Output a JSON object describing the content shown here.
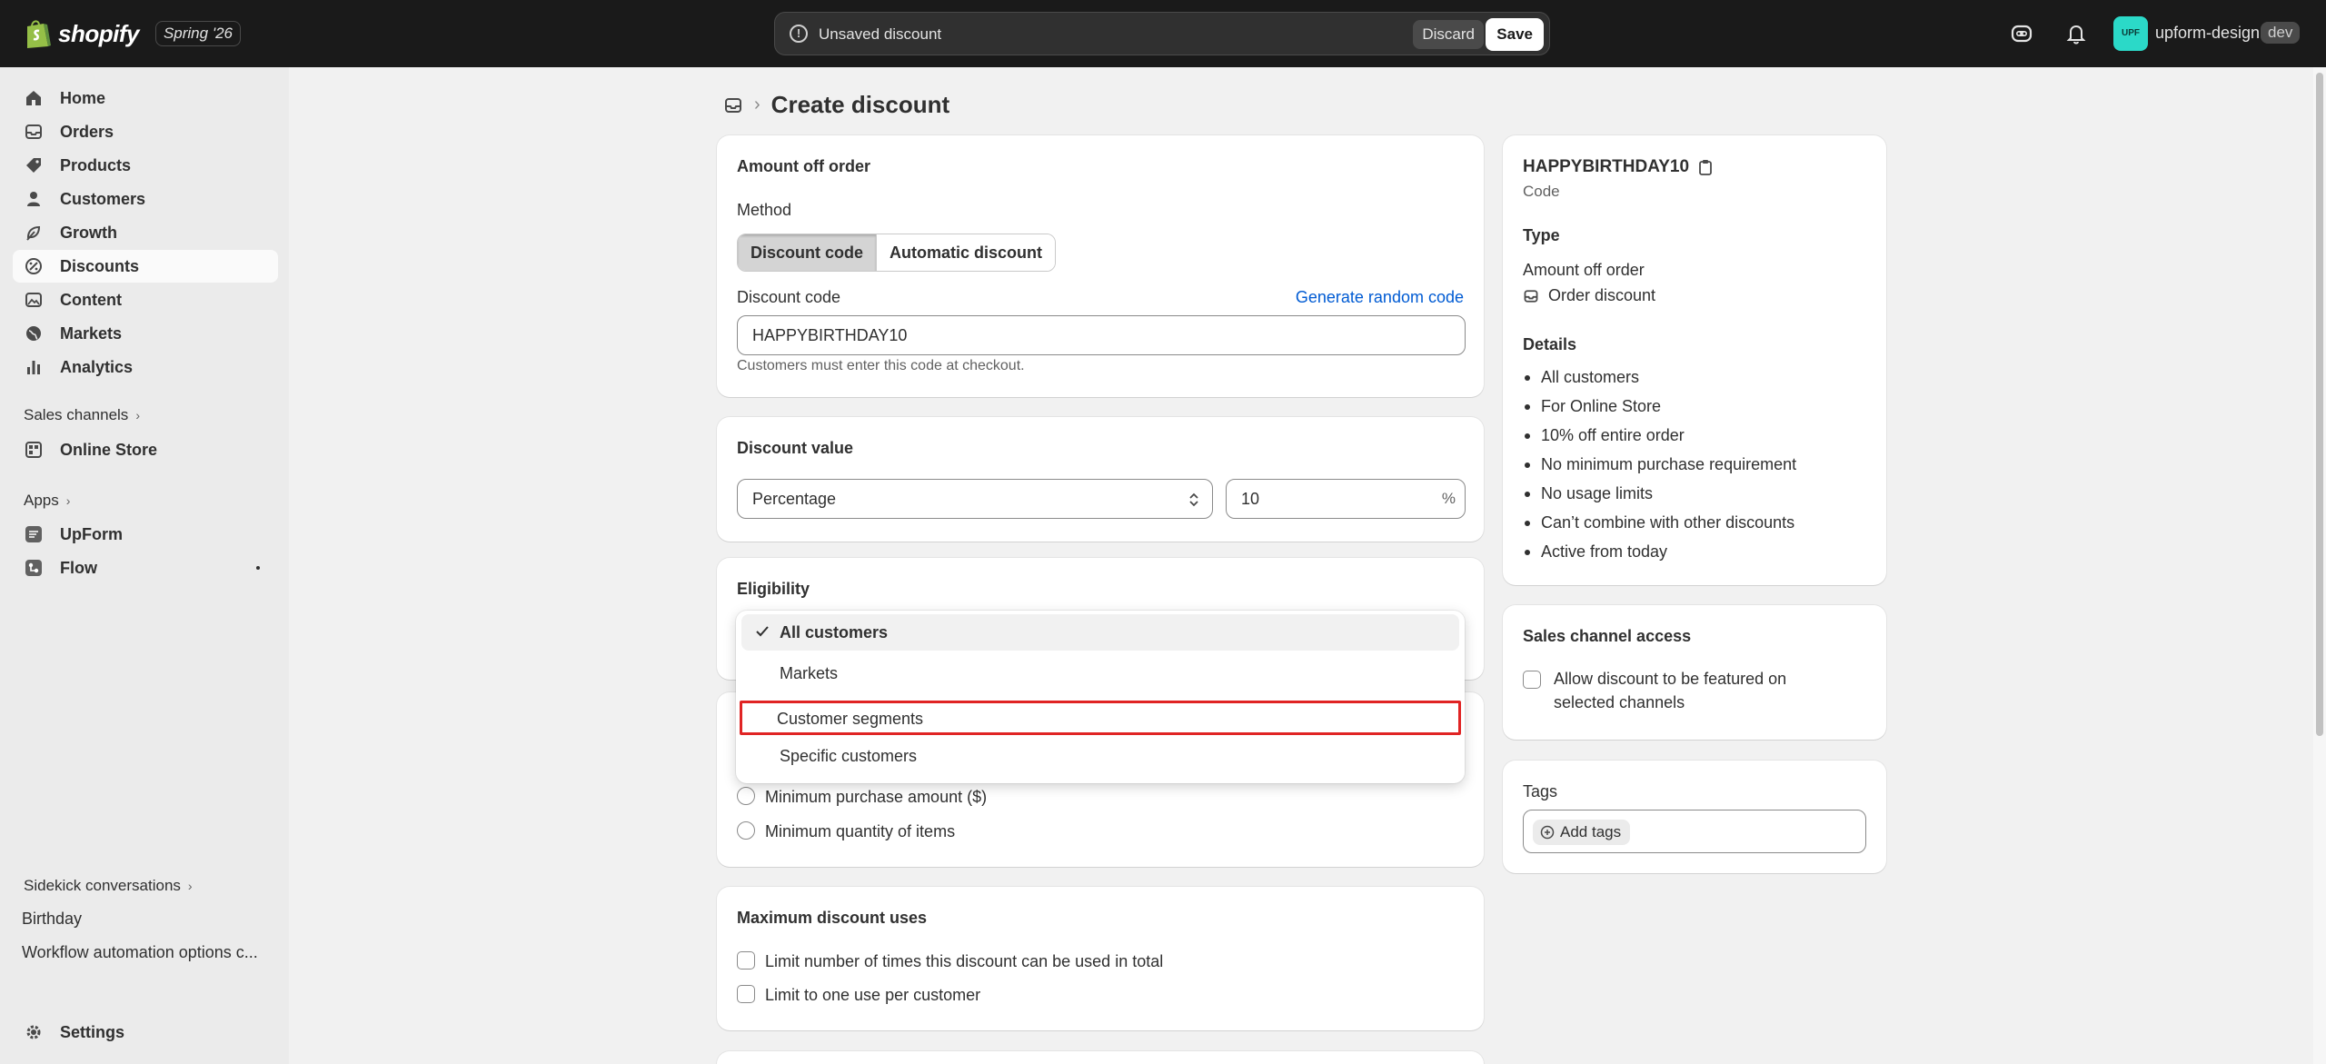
{
  "topbar": {
    "brand": "shopify",
    "edition": "Spring '26",
    "unsaved_text": "Unsaved discount",
    "discard_label": "Discard",
    "save_label": "Save",
    "avatar_initials": "UPF",
    "store_name": "upform-design",
    "badge": "dev"
  },
  "sidebar": {
    "items": [
      {
        "label": "Home",
        "icon": "home-icon"
      },
      {
        "label": "Orders",
        "icon": "inbox-icon"
      },
      {
        "label": "Products",
        "icon": "tag-icon"
      },
      {
        "label": "Customers",
        "icon": "person-icon"
      },
      {
        "label": "Growth",
        "icon": "growth-icon"
      },
      {
        "label": "Discounts",
        "icon": "discount-icon"
      },
      {
        "label": "Content",
        "icon": "content-icon"
      },
      {
        "label": "Markets",
        "icon": "globe-icon"
      },
      {
        "label": "Analytics",
        "icon": "bar-chart-icon"
      }
    ],
    "sales_channels_label": "Sales channels",
    "online_store_label": "Online Store",
    "apps_label": "Apps",
    "upform_label": "UpForm",
    "flow_label": "Flow",
    "sidekick_label": "Sidekick conversations",
    "conversations": [
      "Birthday",
      "Workflow automation options c..."
    ],
    "settings_label": "Settings"
  },
  "page": {
    "title": "Create discount"
  },
  "amount_card": {
    "title": "Amount off order",
    "method_label": "Method",
    "method_options": [
      "Discount code",
      "Automatic discount"
    ],
    "code_label": "Discount code",
    "generate_label": "Generate random code",
    "code_value": "HAPPYBIRTHDAY10",
    "code_help": "Customers must enter this code at checkout."
  },
  "value_card": {
    "title": "Discount value",
    "type_value": "Percentage",
    "amount_value": "10",
    "suffix": "%"
  },
  "eligibility_card": {
    "title": "Eligibility",
    "options": [
      "All customers",
      "Markets",
      "Customer segments",
      "Specific customers"
    ]
  },
  "requirements_card": {
    "options": [
      "Minimum purchase amount ($)",
      "Minimum quantity of items"
    ]
  },
  "max_uses_card": {
    "title": "Maximum discount uses",
    "options": [
      "Limit number of times this discount can be used in total",
      "Limit to one use per customer"
    ]
  },
  "summary": {
    "code": "HAPPYBIRTHDAY10",
    "code_sub": "Code",
    "type_heading": "Type",
    "type_value": "Amount off order",
    "type_detail": "Order discount",
    "details_heading": "Details",
    "details": [
      "All customers",
      "For Online Store",
      "10% off entire order",
      "No minimum purchase requirement",
      "No usage limits",
      "Can’t combine with other discounts",
      "Active from today"
    ]
  },
  "channel_card": {
    "title": "Sales channel access",
    "option_line1": "Allow discount to be featured on",
    "option_line2": "selected channels"
  },
  "tags_card": {
    "title": "Tags",
    "add_label": "Add tags"
  }
}
